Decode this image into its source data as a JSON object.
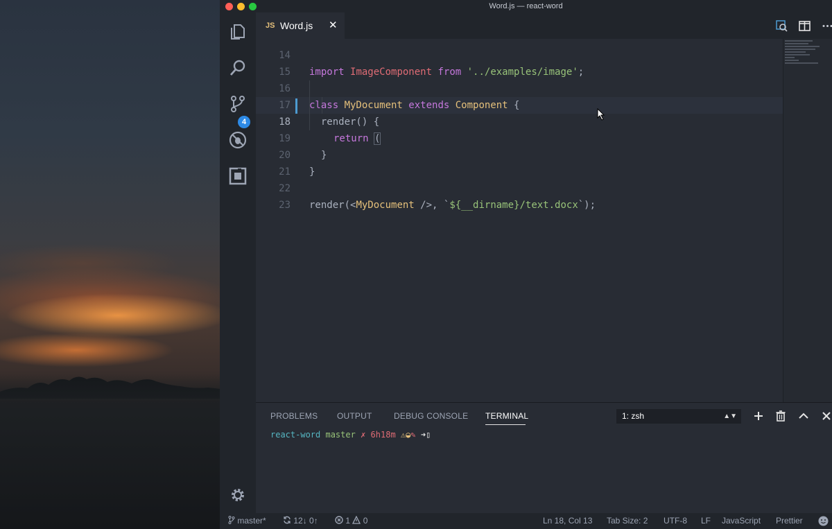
{
  "window": {
    "title": "Word.js — react-word"
  },
  "activity_bar": {
    "items": [
      {
        "name": "explorer-icon"
      },
      {
        "name": "search-icon"
      },
      {
        "name": "source-control-icon",
        "badge": "4"
      },
      {
        "name": "debug-icon"
      },
      {
        "name": "extensions-icon"
      }
    ],
    "settings": "gear-icon"
  },
  "tabs": [
    {
      "icon_label": "JS",
      "label": "Word.js",
      "close": "✕",
      "active": true
    }
  ],
  "editor": {
    "lines": [
      {
        "n": "14",
        "text": "import ImageComponent from '../examples/image';"
      },
      {
        "n": "15",
        "text": ""
      },
      {
        "n": "16",
        "kw1": "class ",
        "c1": "MyDocument",
        "kw2": " extends ",
        "c2": "Component",
        "rest": " {"
      },
      {
        "n": "17",
        "text": "  render() {"
      },
      {
        "n": "18",
        "kw1": "return",
        "rest": " (|"
      },
      {
        "n": "19",
        "text": "}"
      },
      {
        "n": "20",
        "text": "}"
      },
      {
        "n": "21",
        "text": ""
      },
      {
        "n": "22",
        "p1": "render(<",
        "c1": "MyDocument",
        "p2": " />, `",
        "s1": "${__dirname}/text.docx",
        "p3": "`);"
      },
      {
        "n": "23",
        "text": ""
      }
    ],
    "line14_import": "import ",
    "line14_name": "ImageComponent",
    "line14_from": " from ",
    "line14_str": "'../examples/image'",
    "line14_end": ";",
    "line18_paren": "(",
    "current_line": "18",
    "current_column": "13"
  },
  "panel": {
    "tabs": [
      "PROBLEMS",
      "OUTPUT",
      "DEBUG CONSOLE",
      "TERMINAL"
    ],
    "active_tab": "TERMINAL",
    "terminal_select": "1: zsh",
    "prompt": {
      "dir": "react-word",
      "branch": "master",
      "dirty": "✗",
      "time": "6h18m",
      "symbols": "⚠◒",
      "mark": "✎",
      "arrow": "➜",
      "cursor_block": "▯"
    }
  },
  "status_bar": {
    "branch": "master*",
    "sync": "12↓ 0↑",
    "errors": "1",
    "warnings": "0",
    "position": "Ln 18, Col 13",
    "tab_size": "Tab Size: 2",
    "encoding": "UTF-8",
    "eol": "LF",
    "language": "JavaScript",
    "formatter": "Prettier"
  },
  "colors": {
    "keyword": "#c678dd",
    "class": "#e5c07b",
    "string": "#98c379",
    "accent": "#2d8ae6"
  }
}
